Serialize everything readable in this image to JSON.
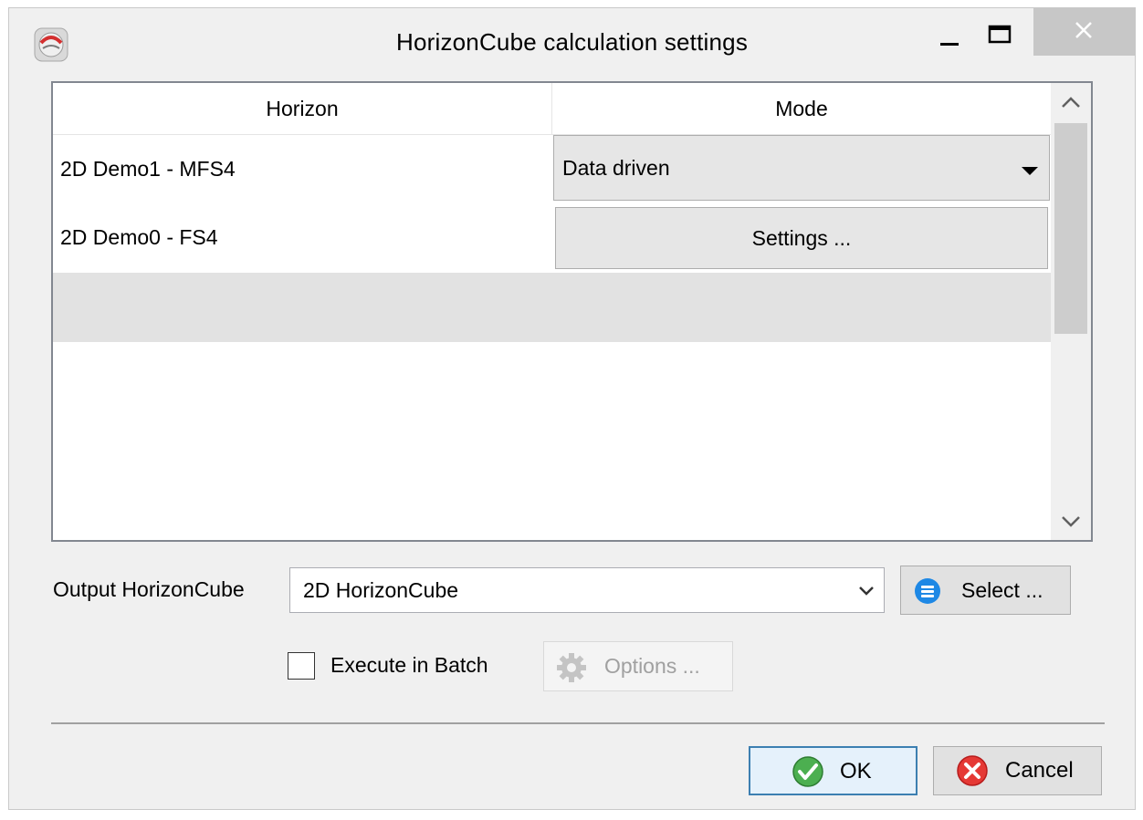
{
  "window": {
    "title": "HorizonCube calculation settings",
    "icon": "app-logo-icon"
  },
  "table": {
    "columns": [
      "Horizon",
      "Mode"
    ],
    "rows": [
      {
        "horizon": "2D Demo1 - MFS4",
        "mode": "Data driven",
        "mode_widget": "dropdown"
      },
      {
        "horizon": "2D Demo0 - FS4",
        "mode": "Settings ...",
        "mode_widget": "button"
      }
    ]
  },
  "output": {
    "label": "Output HorizonCube",
    "value": "2D HorizonCube",
    "select_label": "Select ..."
  },
  "batch": {
    "checkbox_label": "Execute in Batch",
    "checked": false,
    "options_label": "Options ...",
    "options_enabled": false
  },
  "footer": {
    "ok_label": "OK",
    "cancel_label": "Cancel"
  },
  "colors": {
    "dialog_bg": "#f0f0f0",
    "ok_border": "#3c7fb1",
    "ok_icon": "#4caf50",
    "cancel_icon": "#e53935",
    "select_icon": "#1e88e5"
  }
}
